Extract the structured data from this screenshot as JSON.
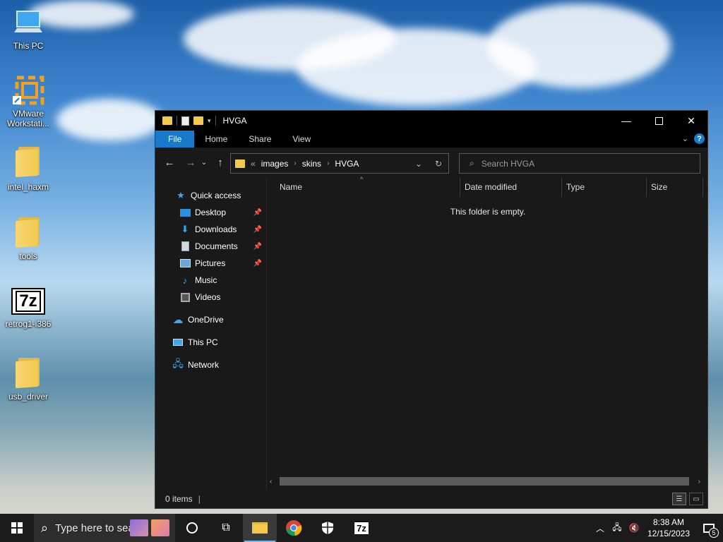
{
  "desktop": {
    "icons": [
      {
        "label": "This PC",
        "icon": "this-pc-icon"
      },
      {
        "label": "VMware Workstati...",
        "icon": "vmware-icon"
      },
      {
        "label": "intel_haxm",
        "icon": "folder-icon"
      },
      {
        "label": "tools",
        "icon": "folder-icon"
      },
      {
        "label": "retrog1-i386",
        "icon": "7zip-icon"
      },
      {
        "label": "usb_driver",
        "icon": "folder-icon"
      }
    ],
    "sevenzip_glyph": "7z"
  },
  "window": {
    "title": "HVGA",
    "ribbon_tabs": [
      "File",
      "Home",
      "Share",
      "View"
    ],
    "help_glyph": "?",
    "address": {
      "overflow": "«",
      "crumbs": [
        "images",
        "skins",
        "HVGA"
      ]
    },
    "search_placeholder": "Search HVGA",
    "nav_pane": {
      "quick_access": "Quick access",
      "quick_items": [
        "Desktop",
        "Downloads",
        "Documents",
        "Pictures",
        "Music",
        "Videos"
      ],
      "onedrive": "OneDrive",
      "this_pc": "This PC",
      "network": "Network"
    },
    "columns": [
      "Name",
      "Date modified",
      "Type",
      "Size"
    ],
    "empty_message": "This folder is empty.",
    "status": "0 items"
  },
  "taskbar": {
    "search_placeholder": "Type here to search",
    "apps": [
      "task-view",
      "file-explorer",
      "chrome",
      "security",
      "7zip"
    ],
    "sevenzip_glyph": "7z",
    "time": "8:38 AM",
    "date": "12/15/2023",
    "notification_count": "5"
  },
  "colors": {
    "accent": "#1979ca",
    "window_bg": "#191919",
    "taskbar_bg": "#1b1b1b",
    "folder": "#f2c94c"
  }
}
